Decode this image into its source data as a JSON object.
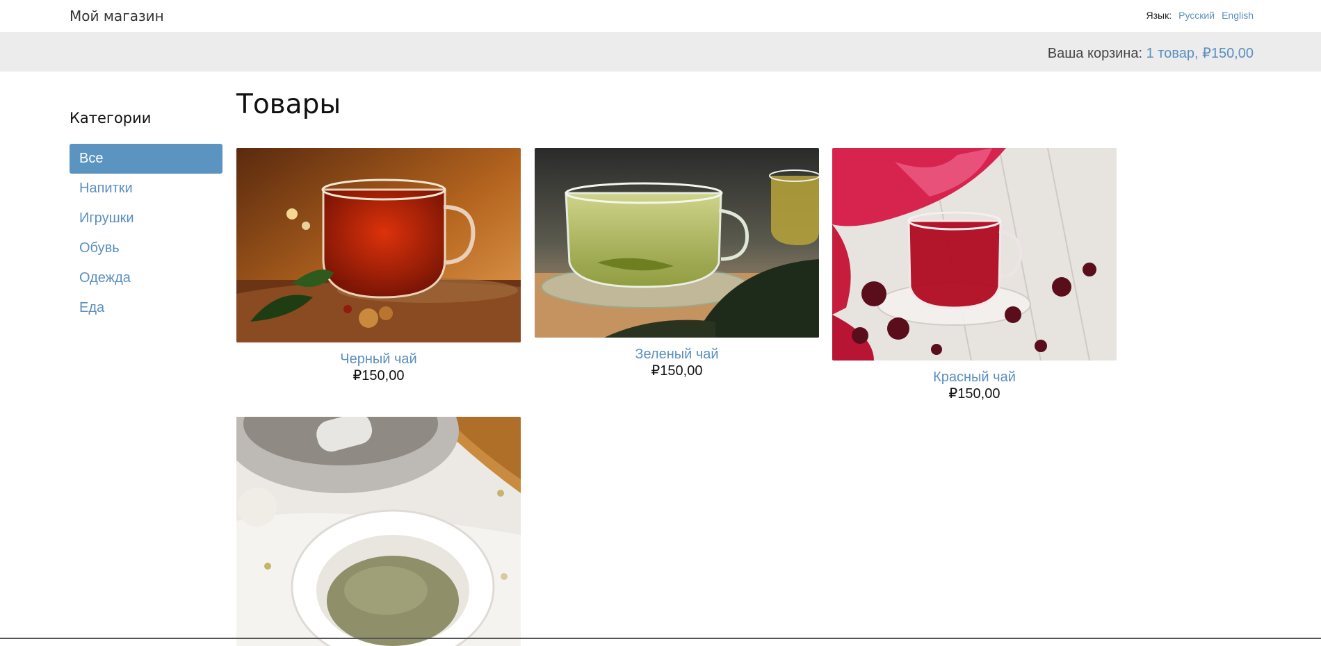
{
  "header": {
    "brand": "Мой магазин",
    "language_label": "Язык:",
    "languages": [
      "Русский",
      "English"
    ]
  },
  "cart": {
    "label": "Ваша корзина:",
    "summary": "1 товар, ₽150,00"
  },
  "sidebar": {
    "title": "Категории",
    "items": [
      {
        "label": "Все",
        "active": true
      },
      {
        "label": "Напитки"
      },
      {
        "label": "Игрушки"
      },
      {
        "label": "Обувь"
      },
      {
        "label": "Одежда"
      },
      {
        "label": "Еда"
      }
    ]
  },
  "main": {
    "title": "Товары",
    "products": [
      {
        "name": "Черный чай",
        "price": "₽150,00",
        "image": "black-tea-image"
      },
      {
        "name": "Зеленый чай",
        "price": "₽150,00",
        "image": "green-tea-image"
      },
      {
        "name": "Красный чай",
        "price": "₽150,00",
        "image": "red-tea-image"
      },
      {
        "name": "",
        "price": "",
        "image": "herbal-powder-image"
      }
    ]
  },
  "colors": {
    "accent": "#5b8fbf",
    "active_bg": "#5b94c1",
    "cart_bar_bg": "#ececec"
  }
}
